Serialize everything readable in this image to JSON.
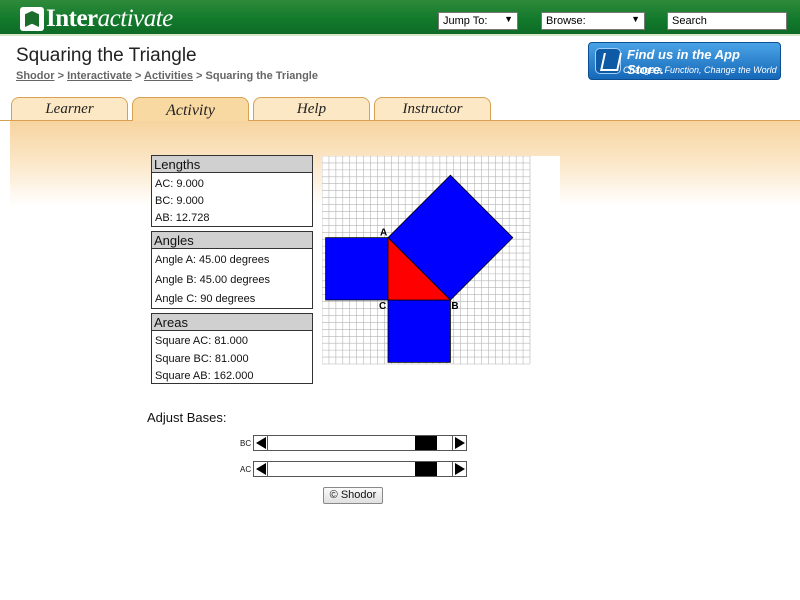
{
  "header": {
    "logo_text_bold": "Inter",
    "logo_text_italic": "activate",
    "jump_to": "Jump To:",
    "browse": "Browse:",
    "search_placeholder": "Search"
  },
  "page": {
    "title": "Squaring the Triangle",
    "breadcrumb": [
      "Shodor",
      "Interactivate",
      "Activities",
      "Squaring the Triangle"
    ],
    "breadcrumb_sep": ">"
  },
  "app_store": {
    "line1": "Find us in the App Store.",
    "line2": "Change a Function, Change the World"
  },
  "tabs": [
    {
      "label": "Learner",
      "active": false
    },
    {
      "label": "Activity",
      "active": true
    },
    {
      "label": "Help",
      "active": false
    },
    {
      "label": "Instructor",
      "active": false
    }
  ],
  "lengths": {
    "header": "Lengths",
    "rows": [
      "AC: 9.000",
      "BC: 9.000",
      "AB: 12.728"
    ]
  },
  "angles": {
    "header": "Angles",
    "rows": [
      "Angle A: 45.00 degrees",
      "Angle B: 45.00 degrees",
      "Angle C: 90 degrees"
    ]
  },
  "areas": {
    "header": "Areas",
    "rows": [
      "Square AC: 81.000",
      "Square BC: 81.000",
      "Square AB: 162.000"
    ]
  },
  "graph": {
    "vertex_labels": {
      "A": "A",
      "B": "B",
      "C": "C"
    },
    "base_bc": 9,
    "base_ac": 9,
    "colors": {
      "squares": "#0000ff",
      "triangle": "#ff0000",
      "grid": "#b4b4b4"
    }
  },
  "controls": {
    "adjust_label": "Adjust Bases:",
    "slider_bc_label": "BC",
    "slider_ac_label": "AC",
    "slider_bc_value_fraction": 0.91,
    "slider_ac_value_fraction": 0.91,
    "shodor_button": "© Shodor"
  }
}
